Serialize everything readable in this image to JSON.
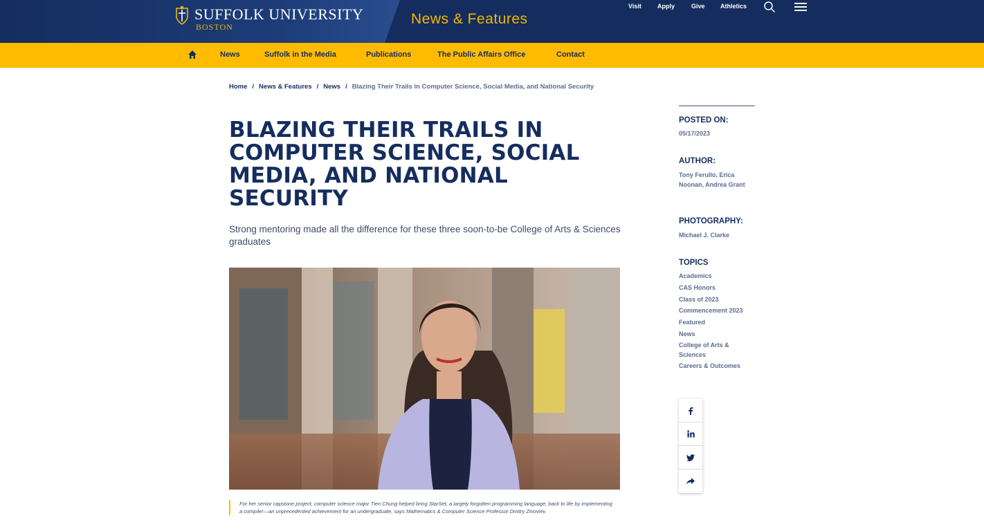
{
  "header": {
    "logo_main": "SUFFOLK UNIVERSITY",
    "logo_sub": "BOSTON",
    "site_title": "News & Features",
    "util_links": [
      "Visit",
      "Apply",
      "Give",
      "Athletics"
    ],
    "search_icon": "search-icon",
    "menu_icon": "hamburger-menu-icon"
  },
  "nav": {
    "home_icon": "home-icon",
    "items": [
      "News",
      "Suffolk in the Media",
      "Publications",
      "The Public Affairs Office",
      "Contact"
    ]
  },
  "breadcrumb": {
    "items": [
      "Home",
      "News & Features",
      "News"
    ],
    "separator": "/",
    "current": "Blazing Their Trails in Computer Science, Social Media, and National Security"
  },
  "article": {
    "title": "Blazing Their Trails in Computer Science, Social Media, and National Security",
    "subtitle": "Strong mentoring made all the difference for these three soon-to-be College of Arts & Sciences graduates",
    "caption": "For her senior capstone project, computer science major Tien Chung helped bring StarSet, a largely forgotten programming language, back to life by implementing a compiler—an unprecedented achievement for an undergraduate, says Mathematics & Computer Science Professor Dmitry Zinoviev."
  },
  "sidebar": {
    "posted_label": "POSTED ON:",
    "posted_value": "05/17/2023",
    "author_label": "AUTHOR:",
    "author_value": "Tony Ferullo, Erica Noonan, Andrea Grant",
    "photo_label": "PHOTOGRAPHY:",
    "photo_value": "Michael J. Clarke",
    "topics_label": "TOPICS",
    "topics": [
      "Academics",
      "CAS Honors",
      "Class of 2023",
      "Commencement 2023",
      "Featured",
      "News",
      "College of Arts & Sciences",
      "Careers & Outcomes"
    ]
  },
  "share": {
    "icons": [
      "facebook-icon",
      "linkedin-icon",
      "twitter-icon",
      "share-icon"
    ]
  },
  "colors": {
    "navy": "#152d5e",
    "gold": "#ffbb00",
    "muted": "#5d6b8f"
  }
}
